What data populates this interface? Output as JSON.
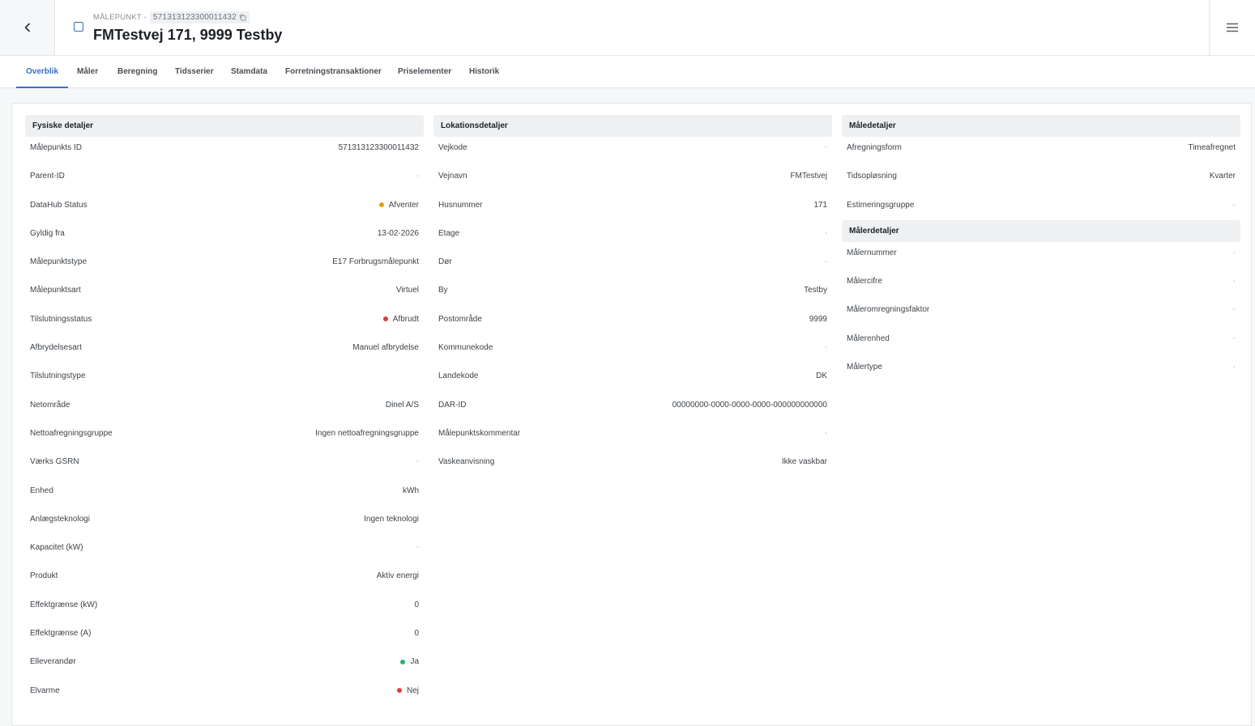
{
  "header": {
    "eyebrow": "MÅLEPUNKT -",
    "id": "571313123300011432",
    "title": "FMTestvej 171, 9999 Testby"
  },
  "tabs": [
    {
      "label": "Overblik"
    },
    {
      "label": "Måler"
    },
    {
      "label": "Beregning"
    },
    {
      "label": "Tidsserier"
    },
    {
      "label": "Stamdata"
    },
    {
      "label": "Forretningstransaktioner"
    },
    {
      "label": "Priselementer"
    },
    {
      "label": "Historik"
    }
  ],
  "colors": {
    "accent": "#3a6fc2",
    "status_yellow": "#e3a008",
    "status_red": "#e03c3c",
    "status_green": "#2bb36b"
  },
  "fysiske": {
    "title": "Fysiske detaljer",
    "rows": [
      {
        "label": "Målepunkts ID",
        "value": "571313123300011432"
      },
      {
        "label": "Parent-ID",
        "value": "-"
      },
      {
        "label": "DataHub Status",
        "value": "Afventer",
        "status": "yellow"
      },
      {
        "label": "Gyldig fra",
        "value": "13-02-2026"
      },
      {
        "label": "Målepunktstype",
        "value": "E17 Forbrugsmålepunkt"
      },
      {
        "label": "Målepunktsart",
        "value": "Virtuel"
      },
      {
        "label": "Tilslutningsstatus",
        "value": "Afbrudt",
        "status": "red"
      },
      {
        "label": "Afbrydelsesart",
        "value": "Manuel afbrydelse"
      },
      {
        "label": "Tilslutningstype",
        "value": ""
      },
      {
        "label": "Netområde",
        "value": "Dinel A/S"
      },
      {
        "label": "Nettoafregningsgruppe",
        "value": "Ingen nettoafregningsgruppe"
      },
      {
        "label": "Værks GSRN",
        "value": "-"
      },
      {
        "label": "Enhed",
        "value": "kWh"
      },
      {
        "label": "Anlægsteknologi",
        "value": "Ingen teknologi"
      },
      {
        "label": "Kapacitet (kW)",
        "value": "-"
      },
      {
        "label": "Produkt",
        "value": "Aktiv energi"
      },
      {
        "label": "Effektgrænse (kW)",
        "value": "0"
      },
      {
        "label": "Effektgrænse (A)",
        "value": "0"
      },
      {
        "label": "Elleverandør",
        "value": "Ja",
        "status": "green"
      },
      {
        "label": "Elvarme",
        "value": "Nej",
        "status": "red"
      }
    ]
  },
  "lokation": {
    "title": "Lokationsdetaljer",
    "rows": [
      {
        "label": "Vejkode",
        "value": "-"
      },
      {
        "label": "Vejnavn",
        "value": "FMTestvej"
      },
      {
        "label": "Husnummer",
        "value": "171"
      },
      {
        "label": "Etage",
        "value": "-"
      },
      {
        "label": "Dør",
        "value": "-"
      },
      {
        "label": "By",
        "value": "Testby"
      },
      {
        "label": "Postområde",
        "value": "9999"
      },
      {
        "label": "Kommunekode",
        "value": "-"
      },
      {
        "label": "Landekode",
        "value": "DK"
      },
      {
        "label": "DAR-ID",
        "value": "00000000-0000-0000-0000-000000000000"
      },
      {
        "label": "Målepunktskommentar",
        "value": "-"
      },
      {
        "label": "Vaskeanvisning",
        "value": "Ikke vaskbar"
      }
    ]
  },
  "maaledetaljer": {
    "title": "Måledetaljer",
    "rows": [
      {
        "label": "Afregningsform",
        "value": "Timeafregnet"
      },
      {
        "label": "Tidsopløsning",
        "value": "Kvarter"
      },
      {
        "label": "Estimeringsgruppe",
        "value": "-"
      }
    ]
  },
  "maalerdetaljer": {
    "title": "Målerdetaljer",
    "rows": [
      {
        "label": "Målernummer",
        "value": "-"
      },
      {
        "label": "Målercifre",
        "value": "-"
      },
      {
        "label": "Måleromregningsfaktor",
        "value": "-"
      },
      {
        "label": "Målerenhed",
        "value": "-"
      },
      {
        "label": "Målertype",
        "value": "-"
      }
    ]
  }
}
